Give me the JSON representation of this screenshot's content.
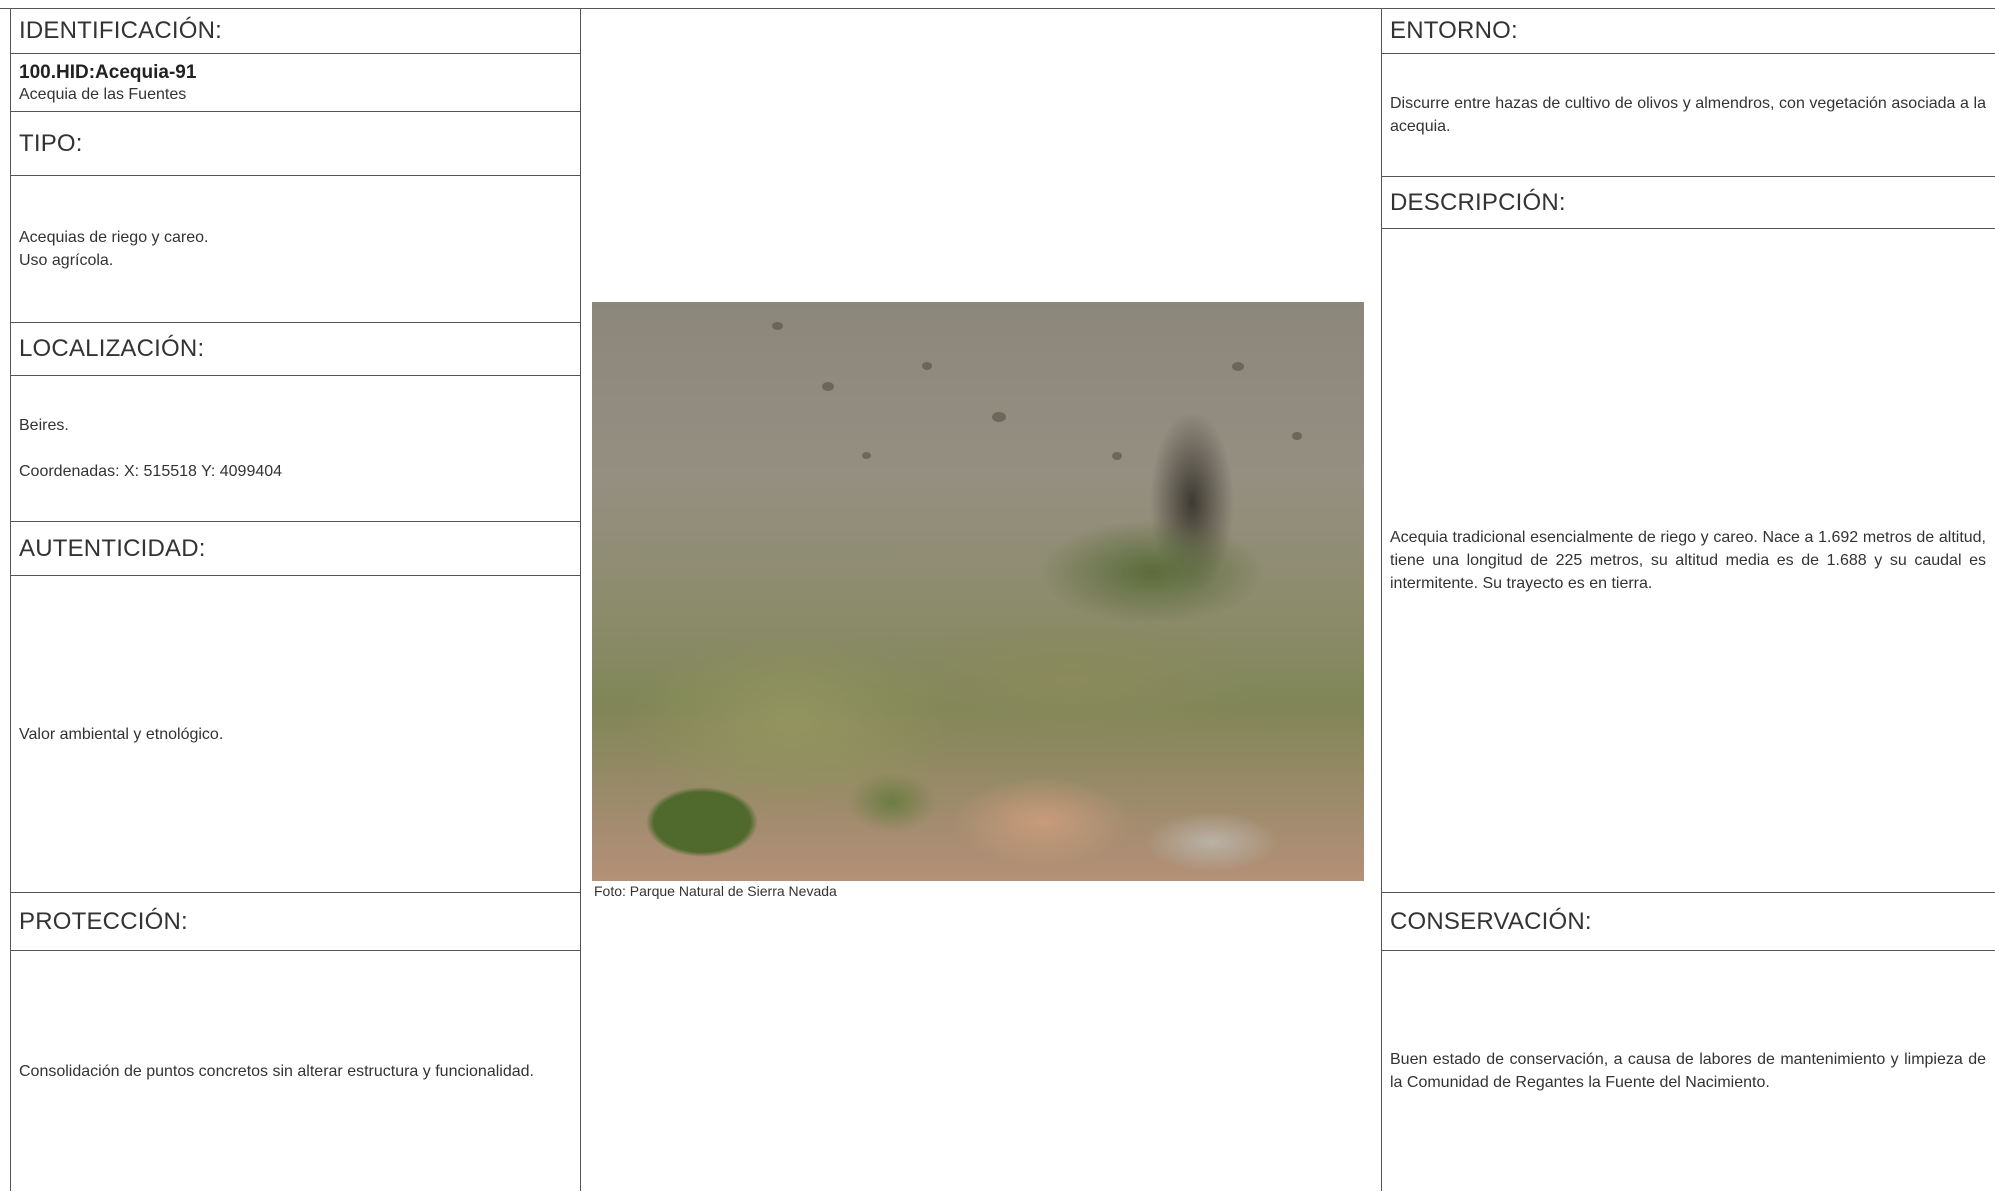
{
  "identificacion": {
    "header": "IDENTIFICACIÓN:",
    "code": "100.HID:Acequia-91",
    "name": "Acequia de las Fuentes"
  },
  "tipo": {
    "header": "TIPO:",
    "line1": "Acequias de riego y careo.",
    "line2": "Uso agrícola."
  },
  "localizacion": {
    "header": "LOCALIZACIÓN:",
    "place": "Beires.",
    "coords": "Coordenadas: X: 515518 Y: 4099404"
  },
  "autenticidad": {
    "header": "AUTENTICIDAD:",
    "text": "Valor ambiental y etnológico."
  },
  "proteccion": {
    "header": "PROTECCIÓN:",
    "text": "Consolidación de puntos concretos sin alterar estructura y funcionalidad."
  },
  "photo": {
    "caption": "Foto: Parque Natural de Sierra Nevada"
  },
  "entorno": {
    "header": "ENTORNO:",
    "text": "Discurre entre hazas de cultivo de olivos y almendros, con vegetación asociada a la acequia."
  },
  "descripcion": {
    "header": "DESCRIPCIÓN:",
    "text": "Acequia tradicional esencialmente de riego y careo. Nace a 1.692 metros de altitud, tiene una longitud de 225 metros, su altitud media es de 1.688 y su caudal es intermitente. Su trayecto es en tierra."
  },
  "conservacion": {
    "header": "CONSERVACIÓN:",
    "text": "Buen estado de conservación, a causa de labores de mantenimiento y limpieza de la Comunidad de Regantes la Fuente del Nacimiento."
  }
}
